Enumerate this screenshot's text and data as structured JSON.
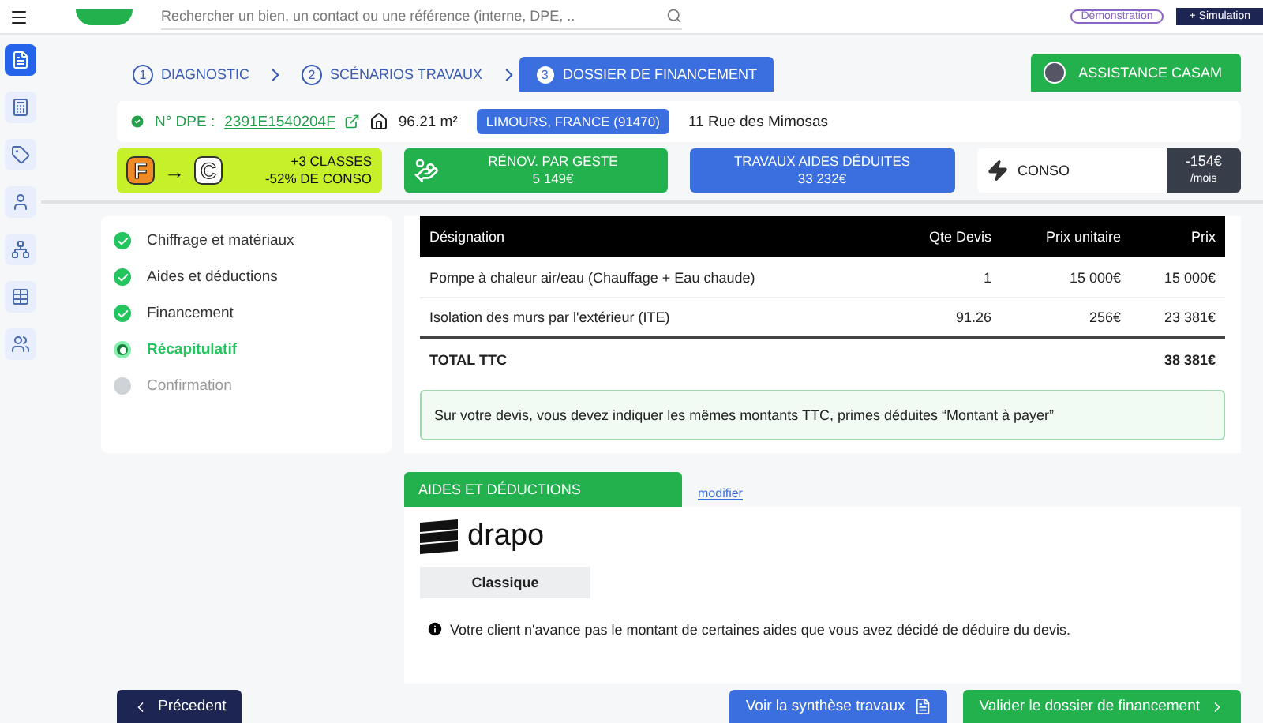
{
  "search": {
    "placeholder": "Rechercher un bien, un contact ou une référence (interne, DPE, .."
  },
  "header_badge": "Démonstration",
  "header_button": "+ Simulation",
  "sidebar": {
    "items": [
      {
        "selected": true
      },
      {
        "selected": false
      },
      {
        "selected": false
      },
      {
        "selected": false
      },
      {
        "selected": false
      },
      {
        "selected": false
      },
      {
        "selected": false
      }
    ]
  },
  "tabs": [
    {
      "number": "1",
      "label": "DIAGNOSTIC",
      "selected": false
    },
    {
      "number": "2",
      "label": "SCÉNARIOS TRAVAUX",
      "selected": false
    },
    {
      "number": "3",
      "label": "DOSSIER DE FINANCEMENT",
      "selected": true
    }
  ],
  "assistance_button": "ASSISTANCE CASAM",
  "property": {
    "dpe_label": "N° DPE :",
    "dpe_number": "2391E1540204F",
    "surface": "96.21 m²",
    "city": "LIMOURS, FRANCE (91470)",
    "address": "11 Rue des Mimosas"
  },
  "summary": {
    "from_class": "F",
    "arrow": "→",
    "to_class": "C",
    "gain": "+3 CLASSES",
    "conso_gain": "-52% DE CONSO",
    "renov_label": "RÉNOV. PAR GESTE",
    "renov_value": "5 149€",
    "aides_label": "TRAVAUX AIDES DÉDUITES",
    "aides_value": "33 232€",
    "conso_label": "CONSO",
    "conso_value": "-154€",
    "conso_unit": "/mois"
  },
  "progress_steps": [
    {
      "label": "Chiffrage et matériaux",
      "completed": true,
      "selected": false
    },
    {
      "label": "Aides et déductions",
      "completed": true,
      "selected": false
    },
    {
      "label": "Financement",
      "completed": true,
      "selected": false
    },
    {
      "label": "Récapitulatif",
      "completed": false,
      "selected": true
    },
    {
      "label": "Confirmation",
      "completed": false,
      "selected": false
    }
  ],
  "table": {
    "columns": [
      "Désignation",
      "Qte Devis",
      "Prix unitaire",
      "Prix"
    ],
    "rows": [
      [
        "Pompe à chaleur air/eau (Chauffage + Eau chaude)",
        "1",
        "15 000€",
        "15 000€"
      ],
      [
        "Isolation des murs par l'extérieur (ITE)",
        "91.26",
        "256€",
        "23 381€"
      ]
    ],
    "total_label": "TOTAL TTC",
    "total_value": "38 381€"
  },
  "notice": "Sur votre devis, vous devez indiquer les mêmes montants TTC, primes déduites “Montant à payer”",
  "aides_section": {
    "title": "AIDES ET DÉDUCTIONS",
    "edit_link": "modifier",
    "logo_text": "drapo",
    "mode": "Classique",
    "info": "Votre client n'avance pas le montant de certaines aides que vous avez décidé de déduire du devis."
  },
  "footer": {
    "previous": "Précedent",
    "synthesis": "Voir la synthèse travaux",
    "validate": "Valider le dossier de financement"
  }
}
